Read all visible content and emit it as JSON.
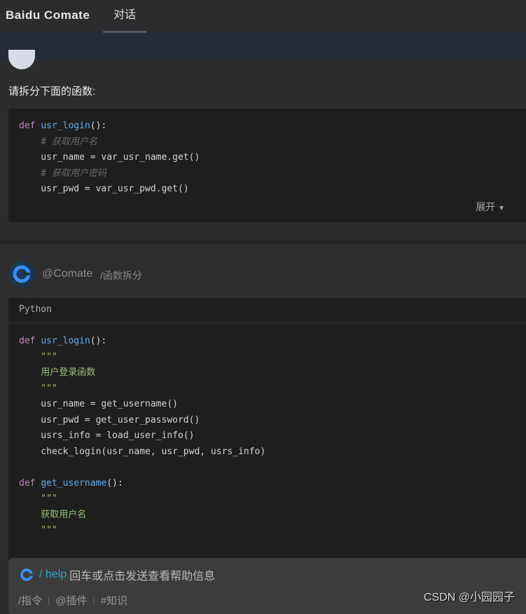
{
  "header": {
    "brand": "Baidu Comate",
    "tab": "对话"
  },
  "user": {
    "prompt": "请拆分下面的函数:",
    "expand_label": "展开",
    "code": [
      [
        [
          "def ",
          "kw"
        ],
        [
          "usr_login",
          "fn"
        ],
        [
          "():",
          ""
        ]
      ],
      [
        [
          "    # 获取用户名",
          "cm"
        ]
      ],
      [
        [
          "    usr_name = var_usr_name.get()",
          ""
        ]
      ],
      [
        [
          "    # 获取用户密码",
          "cm"
        ]
      ],
      [
        [
          "    usr_pwd = var_usr_pwd.get()",
          ""
        ]
      ]
    ]
  },
  "bot": {
    "name": "@Comate",
    "command": "/函数拆分",
    "language": "Python",
    "code": [
      [
        [
          "def ",
          "kw"
        ],
        [
          "usr_login",
          "fn"
        ],
        [
          "():",
          ""
        ]
      ],
      [
        [
          "    \"\"\"",
          "st"
        ]
      ],
      [
        [
          "    用户登录函数",
          "st"
        ]
      ],
      [
        [
          "    \"\"\"",
          "st"
        ]
      ],
      [
        [
          "    usr_name = get_username()",
          ""
        ]
      ],
      [
        [
          "    usr_pwd = get_user_password()",
          ""
        ]
      ],
      [
        [
          "    usrs_info = load_user_info()",
          ""
        ]
      ],
      [
        [
          "    check_login(usr_name, usr_pwd, usrs_info)",
          ""
        ]
      ],
      [
        [
          "",
          ""
        ]
      ],
      [
        [
          "def ",
          "kw"
        ],
        [
          "get_username",
          "fn"
        ],
        [
          "():",
          ""
        ]
      ],
      [
        [
          "    \"\"\"",
          "st"
        ]
      ],
      [
        [
          "    获取用户名",
          "st"
        ]
      ],
      [
        [
          "    \"\"\"",
          "st"
        ]
      ]
    ]
  },
  "input": {
    "slash": "/",
    "help": "help",
    "hint": "回车或点击发送查看帮助信息",
    "tools": [
      "/指令",
      "@插件",
      "#知识"
    ]
  },
  "watermark": "CSDN @小园园子"
}
